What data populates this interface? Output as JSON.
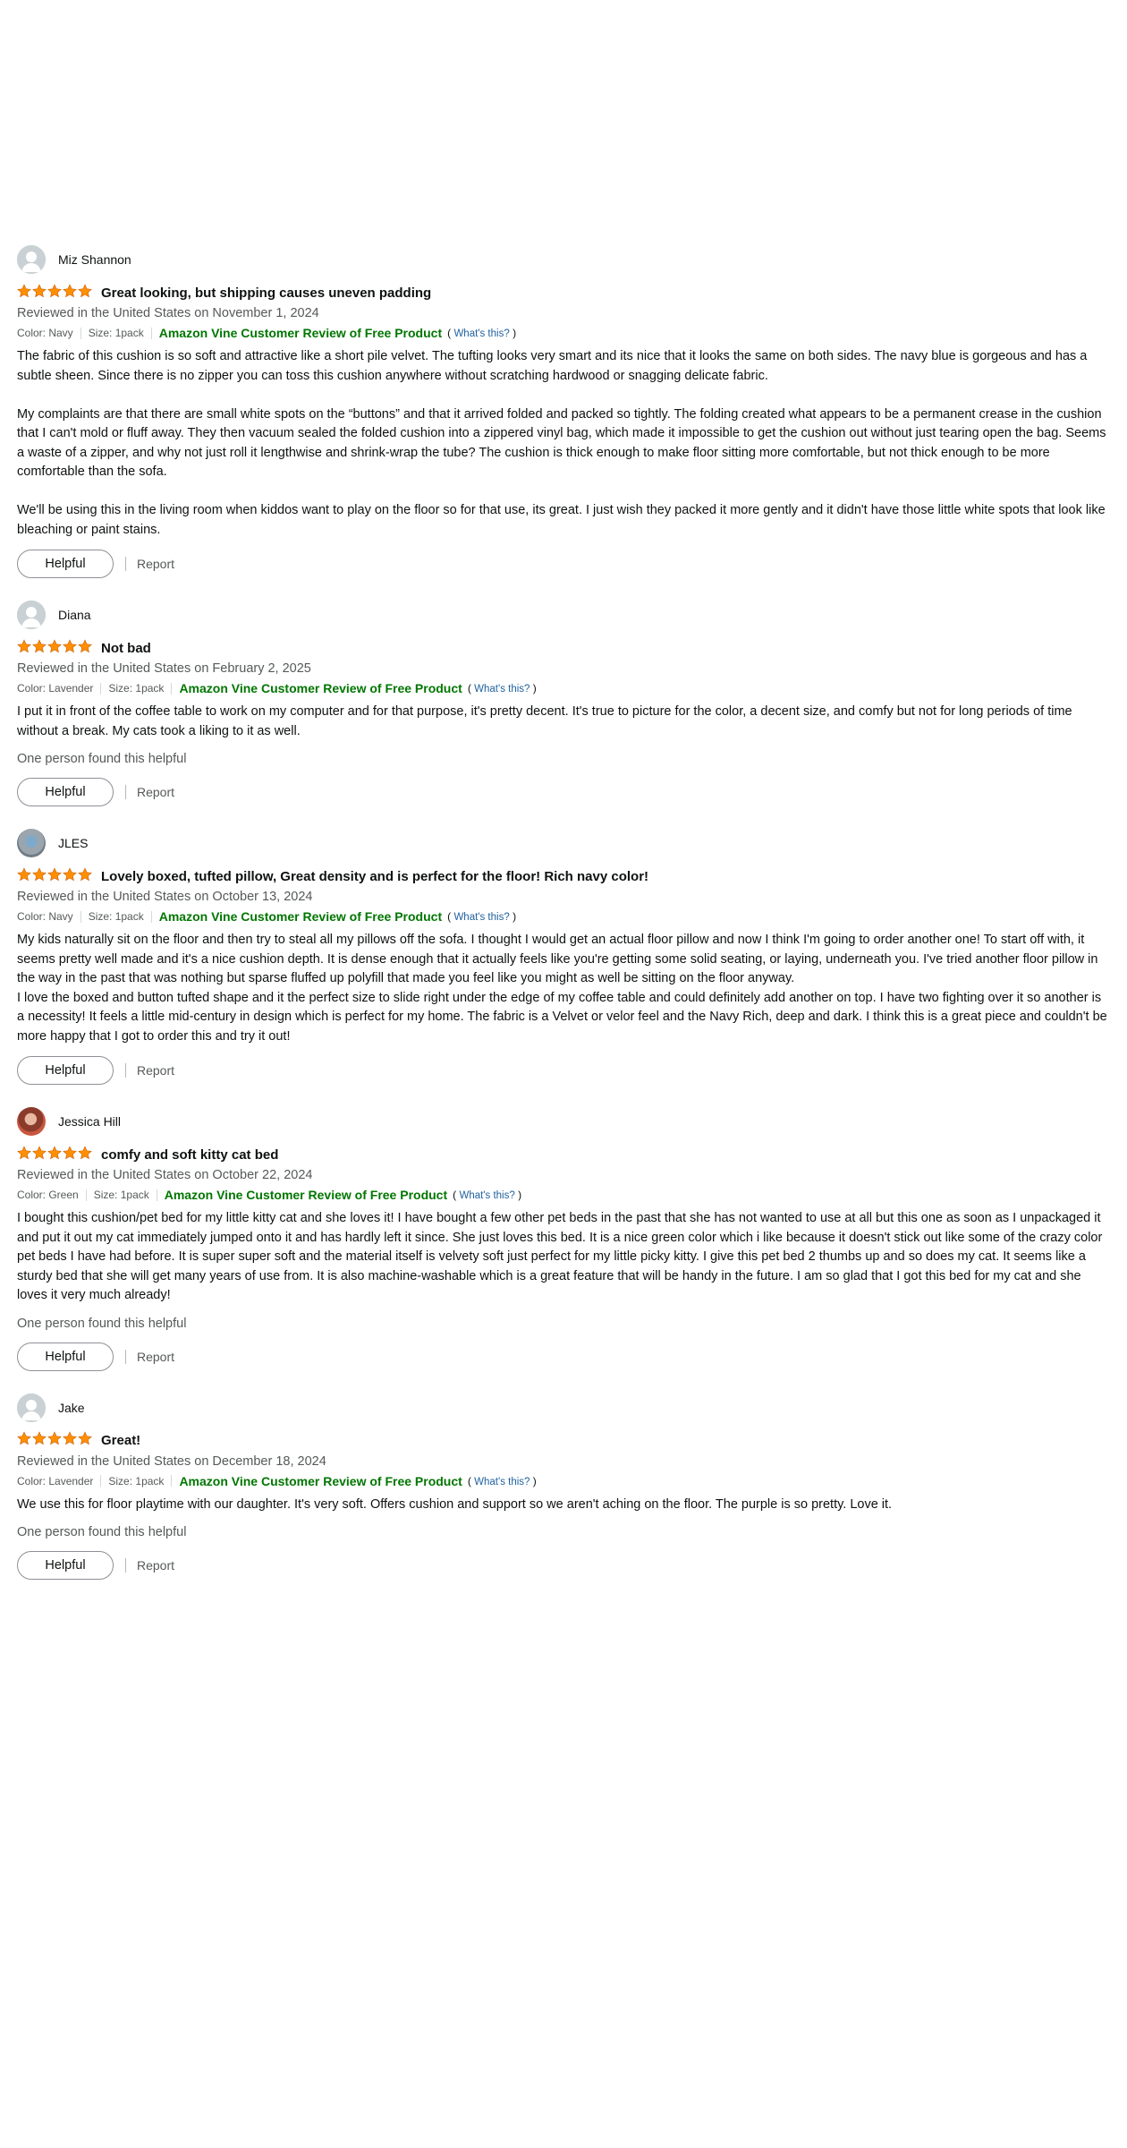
{
  "colors": {
    "star": "#ff8f00",
    "vine": "#007600",
    "link": "#2162a1",
    "muted": "#565959"
  },
  "reviews": [
    {
      "profile_name": "Miz Shannon",
      "avatar": "default-avatar-icon",
      "rating": 5,
      "title": "Great looking, but shipping causes uneven padding",
      "date": "Reviewed in the United States on November 1, 2024",
      "color": "Color: Navy",
      "size": "Size: 1pack",
      "vine": "Amazon Vine Customer Review of Free Product",
      "whats_open": "(",
      "whats_this": "What's this?",
      "whats_close": ")",
      "paragraphs": [
        "The fabric of this cushion is so soft and attractive like a short pile velvet. The tufting looks very smart and its nice that it looks the same on both sides. The navy blue is gorgeous and has a subtle sheen. Since there is no zipper you can toss this cushion anywhere without scratching hardwood or snagging delicate fabric.",
        "My complaints are that there are small white spots on the “buttons” and that it arrived folded and packed so tightly. The folding created what appears to be a permanent crease in the cushion that I can't mold or fluff away. They then vacuum sealed the folded cushion into a zippered vinyl bag, which made it impossible to get the cushion out without just tearing open the bag. Seems a waste of a zipper, and why not just roll it lengthwise and shrink-wrap the tube? The cushion is thick enough to make floor sitting more comfortable, but not thick enough to be more comfortable than the sofa.",
        "We'll be using this in the living room when kiddos want to play on the floor so for that use, its great. I just wish they packed it more gently and it didn't have those little white spots that look like bleaching or paint stains."
      ],
      "helpful_count": "",
      "helpful_label": "Helpful",
      "report_label": "Report"
    },
    {
      "profile_name": "Diana",
      "avatar": "default-avatar-icon",
      "rating": 5,
      "title": "Not bad",
      "date": "Reviewed in the United States on February 2, 2025",
      "color": "Color: Lavender",
      "size": "Size: 1pack",
      "vine": "Amazon Vine Customer Review of Free Product",
      "whats_open": "(",
      "whats_this": "What's this?",
      "whats_close": ")",
      "paragraphs": [
        "I put it in front of the coffee table to work on my computer and for that purpose, it's pretty decent. It's true to picture for the color, a decent size, and comfy but not for long periods of time without a break. My cats took a liking to it as well."
      ],
      "helpful_count": "One person found this helpful",
      "helpful_label": "Helpful",
      "report_label": "Report"
    },
    {
      "profile_name": "JLES",
      "avatar": "user-photo-avatar",
      "rating": 5,
      "title": "Lovely boxed, tufted pillow, Great density and is perfect for the floor! Rich navy color!",
      "date": "Reviewed in the United States on October 13, 2024",
      "color": "Color: Navy",
      "size": "Size: 1pack",
      "vine": "Amazon Vine Customer Review of Free Product",
      "whats_open": "(",
      "whats_this": "What's this?",
      "whats_close": ")",
      "paragraphs": [
        "My kids naturally sit on the floor and then try to steal all my pillows off the sofa. I thought I would get an actual floor pillow and now I think I'm going to order another one! To start off with, it seems pretty well made and it's a nice cushion depth. It is dense enough that it actually feels like you're getting some solid seating, or laying, underneath you. I've tried another floor pillow in the way in the past that was nothing but sparse fluffed up polyfill that made you feel like you might as well be sitting on the floor anyway.",
        "I love the boxed and button tufted shape and it the perfect size to slide right under the edge of my coffee table and could definitely add another on top. I have two fighting over it so another is a necessity! It feels a little mid-century in design which is perfect for my home. The fabric is a Velvet or velor feel and the Navy Rich, deep and dark. I think this is a great piece and couldn't be more happy that I got to order this and try it out!"
      ],
      "helpful_count": "",
      "helpful_label": "Helpful",
      "report_label": "Report"
    },
    {
      "profile_name": "Jessica Hill",
      "avatar": "user-photo-avatar",
      "rating": 5,
      "title": "comfy and soft kitty cat bed",
      "date": "Reviewed in the United States on October 22, 2024",
      "color": "Color: Green",
      "size": "Size: 1pack",
      "vine": "Amazon Vine Customer Review of Free Product",
      "whats_open": "(",
      "whats_this": "What's this?",
      "whats_close": ")",
      "paragraphs": [
        "I bought this cushion/pet bed for my little kitty cat and she loves it! I have bought a few other pet beds in the past that she has not wanted to use at all but this one as soon as I unpackaged it and put it out my cat immediately jumped onto it and has hardly left it since. She just loves this bed. It is a nice green color which i like because it doesn't stick out like some of the crazy color pet beds I have had before. It is super super soft and the material itself is velvety soft just perfect for my little picky kitty. I give this pet bed 2 thumbs up and so does my cat. It seems like a sturdy bed that she will get many years of use from. It is also machine-washable which is a great feature that will be handy in the future. I am so glad that I got this bed for my cat and she loves it very much already!"
      ],
      "helpful_count": "One person found this helpful",
      "helpful_label": "Helpful",
      "report_label": "Report"
    },
    {
      "profile_name": "Jake",
      "avatar": "default-avatar-icon",
      "rating": 5,
      "title": "Great!",
      "date": "Reviewed in the United States on December 18, 2024",
      "color": "Color: Lavender",
      "size": "Size: 1pack",
      "vine": "Amazon Vine Customer Review of Free Product",
      "whats_open": "(",
      "whats_this": "What's this?",
      "whats_close": ")",
      "paragraphs": [
        "We use this for floor playtime with our daughter. It's very soft. Offers cushion and support so we aren't aching on the floor. The purple is so pretty. Love it."
      ],
      "helpful_count": "One person found this helpful",
      "helpful_label": "Helpful",
      "report_label": "Report"
    }
  ]
}
